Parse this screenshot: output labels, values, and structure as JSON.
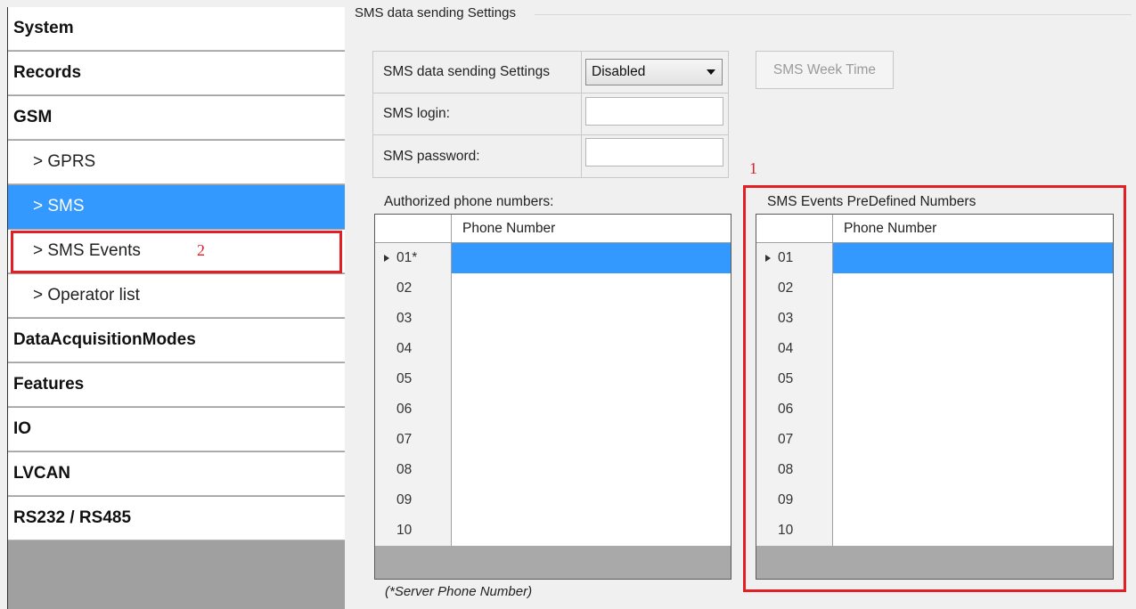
{
  "sidebar": {
    "items": [
      {
        "label": "System"
      },
      {
        "label": "Records"
      },
      {
        "label": "GSM"
      },
      {
        "label": "> GPRS"
      },
      {
        "label": "> SMS"
      },
      {
        "label": "> SMS Events"
      },
      {
        "label": "> Operator list"
      },
      {
        "label": "DataAcquisitionModes"
      },
      {
        "label": "Features"
      },
      {
        "label": "IO"
      },
      {
        "label": "LVCAN"
      },
      {
        "label": "RS232 / RS485"
      }
    ],
    "selected": "> SMS"
  },
  "main": {
    "group_title": "SMS data sending Settings",
    "settings": {
      "sending_label": "SMS data sending Settings",
      "sending_value": "Disabled",
      "login_label": "SMS login:",
      "login_value": "",
      "password_label": "SMS password:",
      "password_value": ""
    },
    "week_time_button": "SMS Week Time",
    "authorized": {
      "caption": "Authorized phone numbers:",
      "column": "Phone Number",
      "rows": [
        "01*",
        "02",
        "03",
        "04",
        "05",
        "06",
        "07",
        "08",
        "09",
        "10"
      ]
    },
    "predefined": {
      "caption": "SMS Events PreDefined Numbers",
      "column": "Phone Number",
      "rows": [
        "01",
        "02",
        "03",
        "04",
        "05",
        "06",
        "07",
        "08",
        "09",
        "10"
      ]
    },
    "footnote": "(*Server Phone Number)"
  },
  "annotations": {
    "marker_1": "1",
    "marker_2": "2",
    "color": "#e31e24"
  },
  "colors": {
    "selection": "#3399ff"
  }
}
